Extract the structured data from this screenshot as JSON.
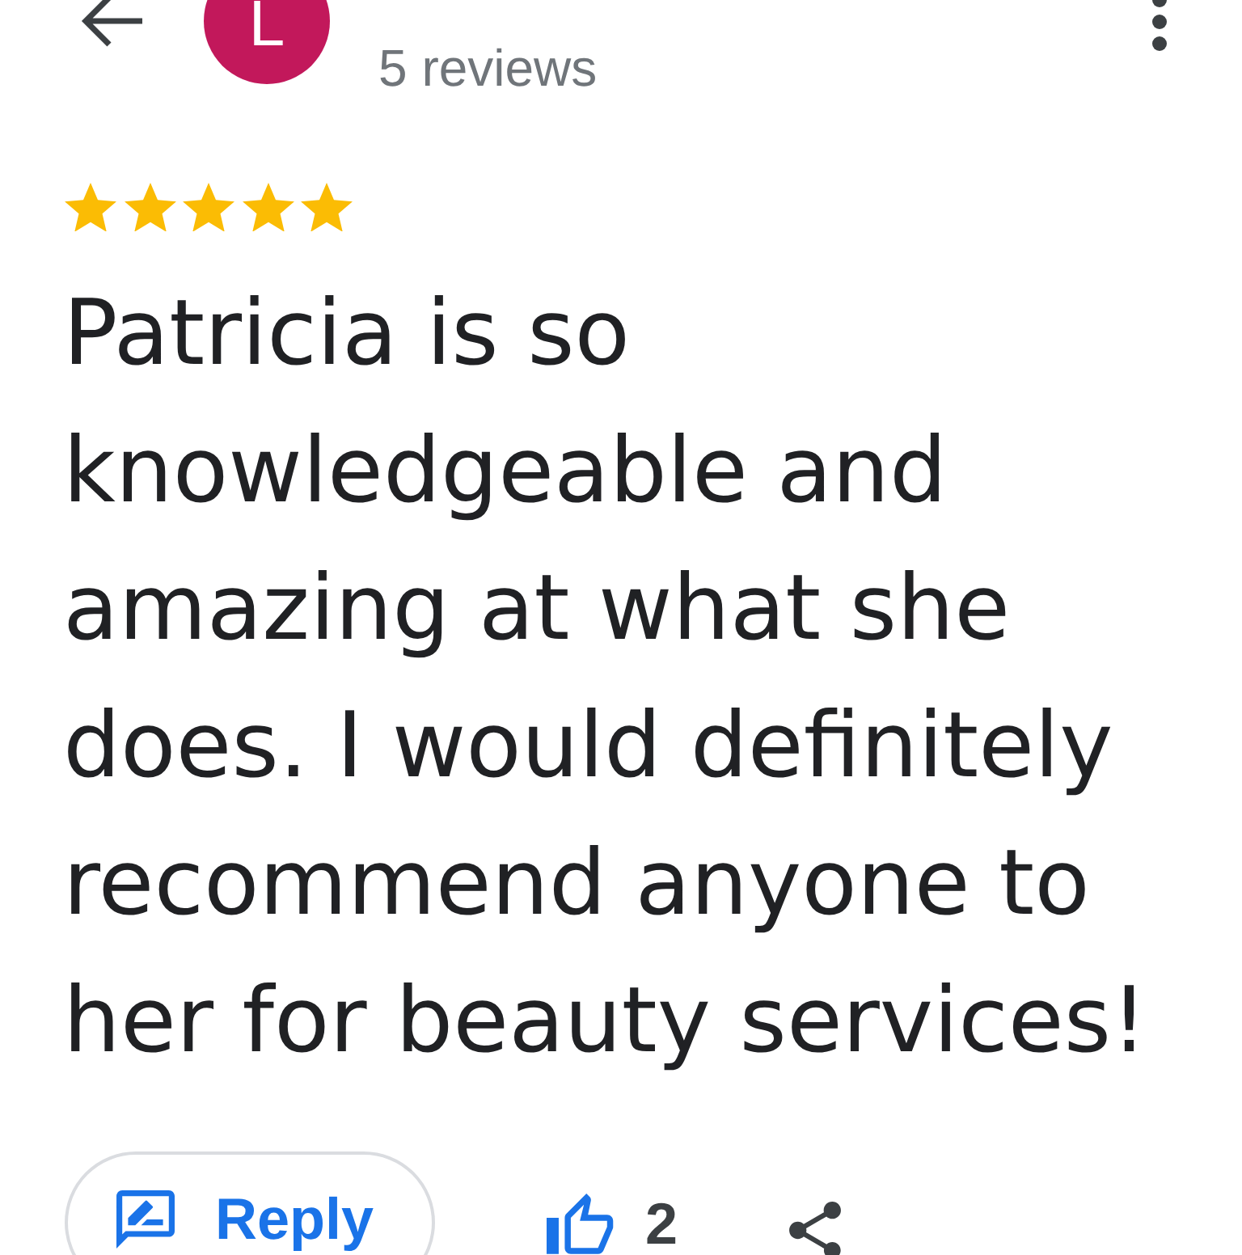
{
  "header": {
    "avatar_letter": "L",
    "review_count": "5 reviews"
  },
  "review": {
    "stars": 5,
    "text": "Patricia is so knowledgeable and amazing at what she does. I would definitely recommend anyone to her for beauty services!"
  },
  "actions": {
    "reply": "Reply",
    "likes": "2",
    "liked": true
  }
}
